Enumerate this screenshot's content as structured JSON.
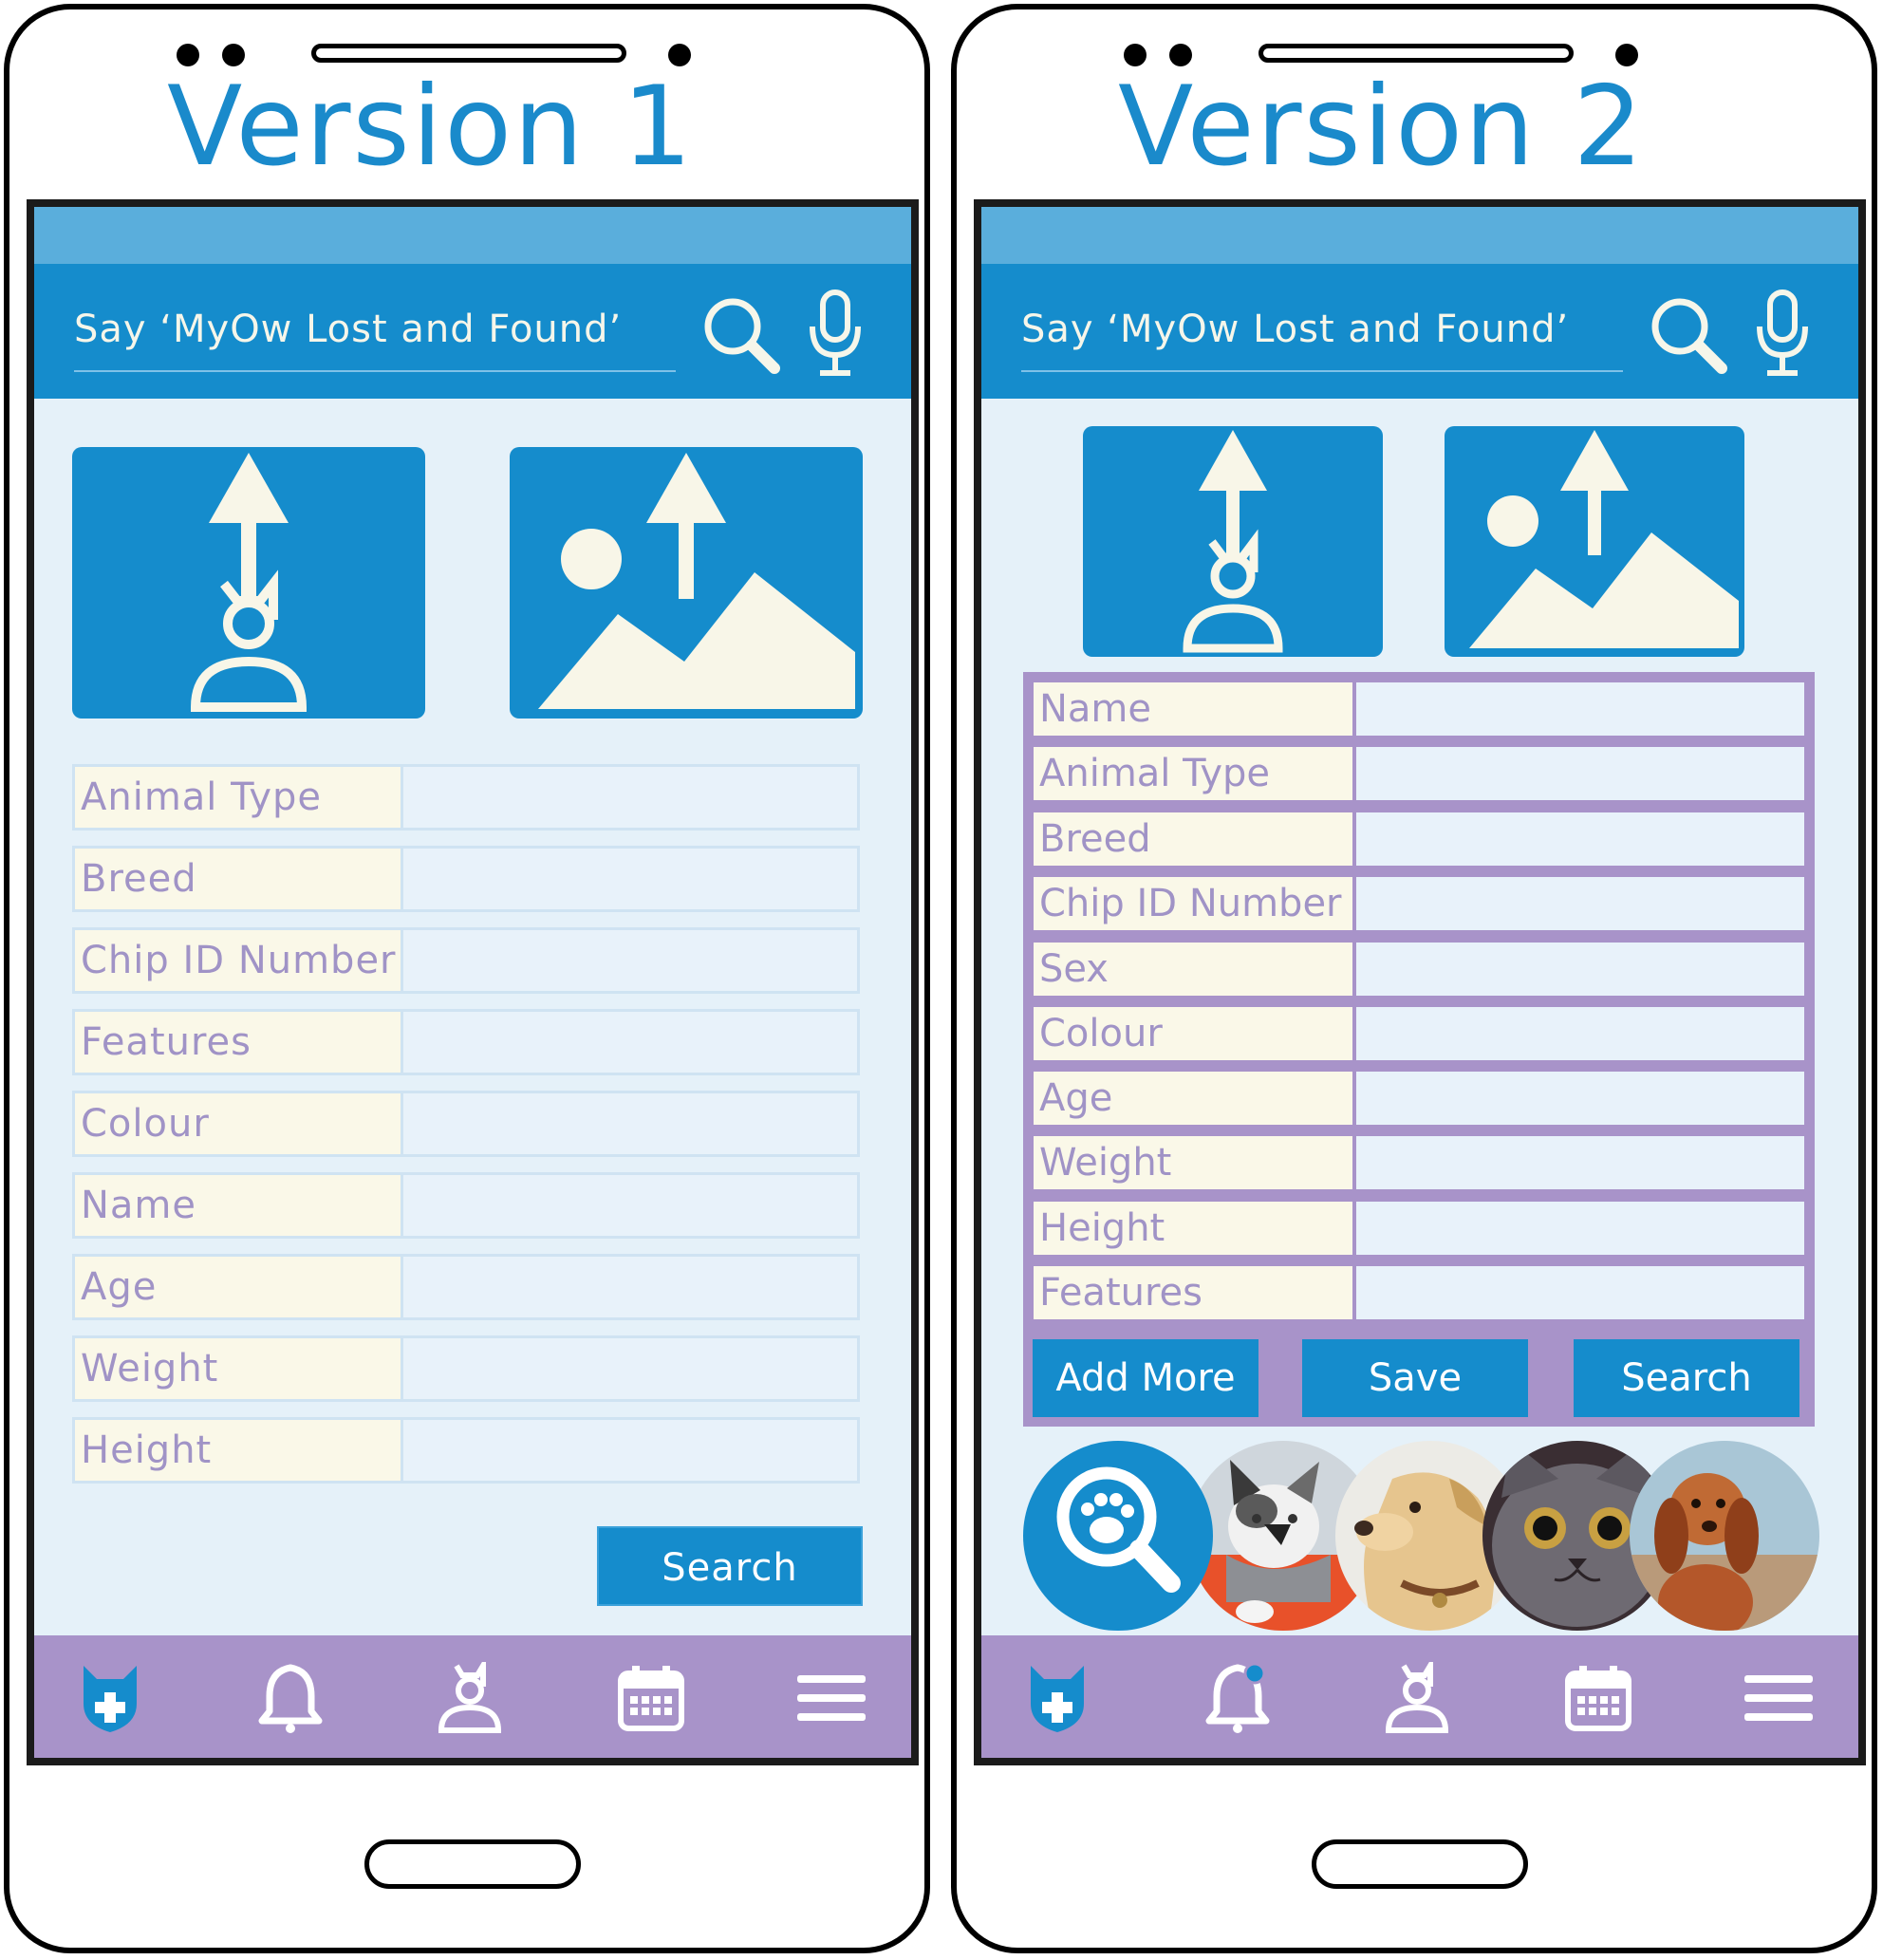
{
  "version1": {
    "title": "Version 1",
    "search_prompt": "Say ‘MyOw Lost and Found’",
    "fields": [
      "Animal Type",
      "Breed",
      "Chip ID Number",
      "Features",
      "Colour",
      "Name",
      "Age",
      "Weight",
      "Height"
    ],
    "search_button": "Search"
  },
  "version2": {
    "title": "Version 2",
    "search_prompt": "Say ‘MyOw Lost and Found’",
    "fields": [
      "Name",
      "Animal Type",
      "Breed",
      "Chip ID Number",
      "Sex",
      "Colour",
      "Age",
      "Weight",
      "Height",
      "Features"
    ],
    "add_more_button": "Add More",
    "save_button": "Save",
    "search_button": "Search"
  },
  "nav_icons": [
    "pet-health-icon",
    "bell-icon",
    "profile-icon",
    "calendar-icon",
    "menu-icon"
  ],
  "colors": {
    "primary": "#158ccc",
    "nav": "#a893c9",
    "background": "#e5f1f9",
    "label_bg": "#faf8e8",
    "label_text": "#a093c6"
  }
}
